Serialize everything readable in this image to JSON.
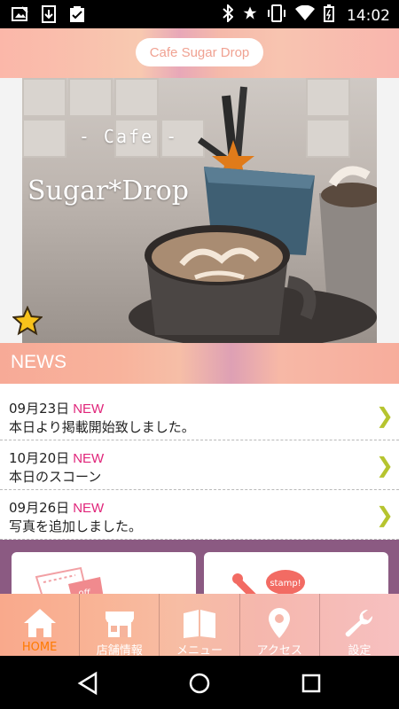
{
  "status_bar": {
    "left_icons": [
      "photo-edit-icon",
      "download-icon",
      "clipboard-check-icon"
    ],
    "right_icons": [
      "bluetooth-icon",
      "star-icon",
      "vibrate-icon",
      "wifi-icon",
      "battery-icon"
    ],
    "time": "14:02"
  },
  "header": {
    "title": "Cafe Sugar Drop"
  },
  "hero": {
    "caption_top": "- Cafe -",
    "caption_main": "Sugar*Drop"
  },
  "news": {
    "section_title": "NEWS",
    "new_badge": "NEW",
    "items": [
      {
        "date": "09月23日",
        "title": "本日より掲載開始致しました。"
      },
      {
        "date": "10月20日",
        "title": "本日のスコーン"
      },
      {
        "date": "09月26日",
        "title": "写真を追加しました。"
      }
    ],
    "arrow": "❯"
  },
  "cards": {
    "off_label": "off",
    "stamp_label": "stamp!"
  },
  "tabs": [
    {
      "label": "HOME",
      "icon": "home-icon",
      "active": true
    },
    {
      "label": "店舗情報",
      "icon": "store-icon",
      "active": false
    },
    {
      "label": "メニュー",
      "icon": "menu-book-icon",
      "active": false
    },
    {
      "label": "アクセス",
      "icon": "map-pin-icon",
      "active": false
    },
    {
      "label": "設定",
      "icon": "wrench-icon",
      "active": false
    }
  ],
  "colors": {
    "new_badge": "#e0257a",
    "arrow": "#b6c42f",
    "active_tab": "#ff7a00",
    "purple_band": "#8b5a82"
  }
}
